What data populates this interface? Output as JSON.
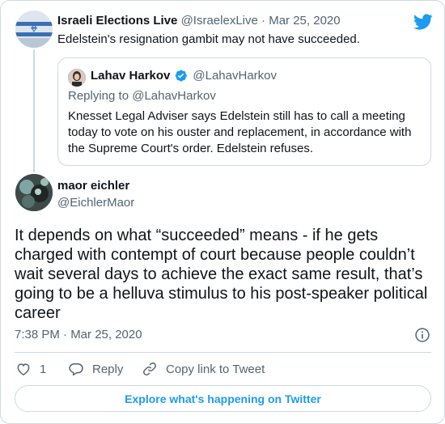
{
  "parent": {
    "name": "Israeli Elections Live",
    "handle": "@IsraelexLive",
    "separator": "·",
    "date": "Mar 25, 2020",
    "text": "Edelstein's resignation gambit may not have succeeded."
  },
  "quoted": {
    "name": "Lahav Harkov",
    "handle": "@LahavHarkov",
    "replying": "Replying to @LahavHarkov",
    "text": "Knesset Legal Adviser says Edelstein still has to call a meeting today to vote on his ouster and replacement, in accordance with the Supreme Court's order. Edelstein refuses."
  },
  "main": {
    "name": "maor eichler",
    "handle": "@EichlerMaor",
    "text": "It depends on what “succeeded” means - if he gets charged with contempt of court because people couldn’t wait several days to achieve the exact same result, that’s going to be a helluva stimulus to his post-speaker political career",
    "timestamp": "7:38 PM · Mar 25, 2020"
  },
  "actions": {
    "like_count": "1",
    "reply_label": "Reply",
    "copy_label": "Copy link to Tweet"
  },
  "explore_label": "Explore what's happening on Twitter",
  "colors": {
    "accent": "#1d9bf0",
    "muted": "#536471",
    "border": "#cfd9de",
    "text": "#0f1419"
  },
  "icons": [
    "twitter-logo-icon",
    "verified-badge-icon",
    "info-icon",
    "heart-icon",
    "reply-icon",
    "link-icon"
  ]
}
